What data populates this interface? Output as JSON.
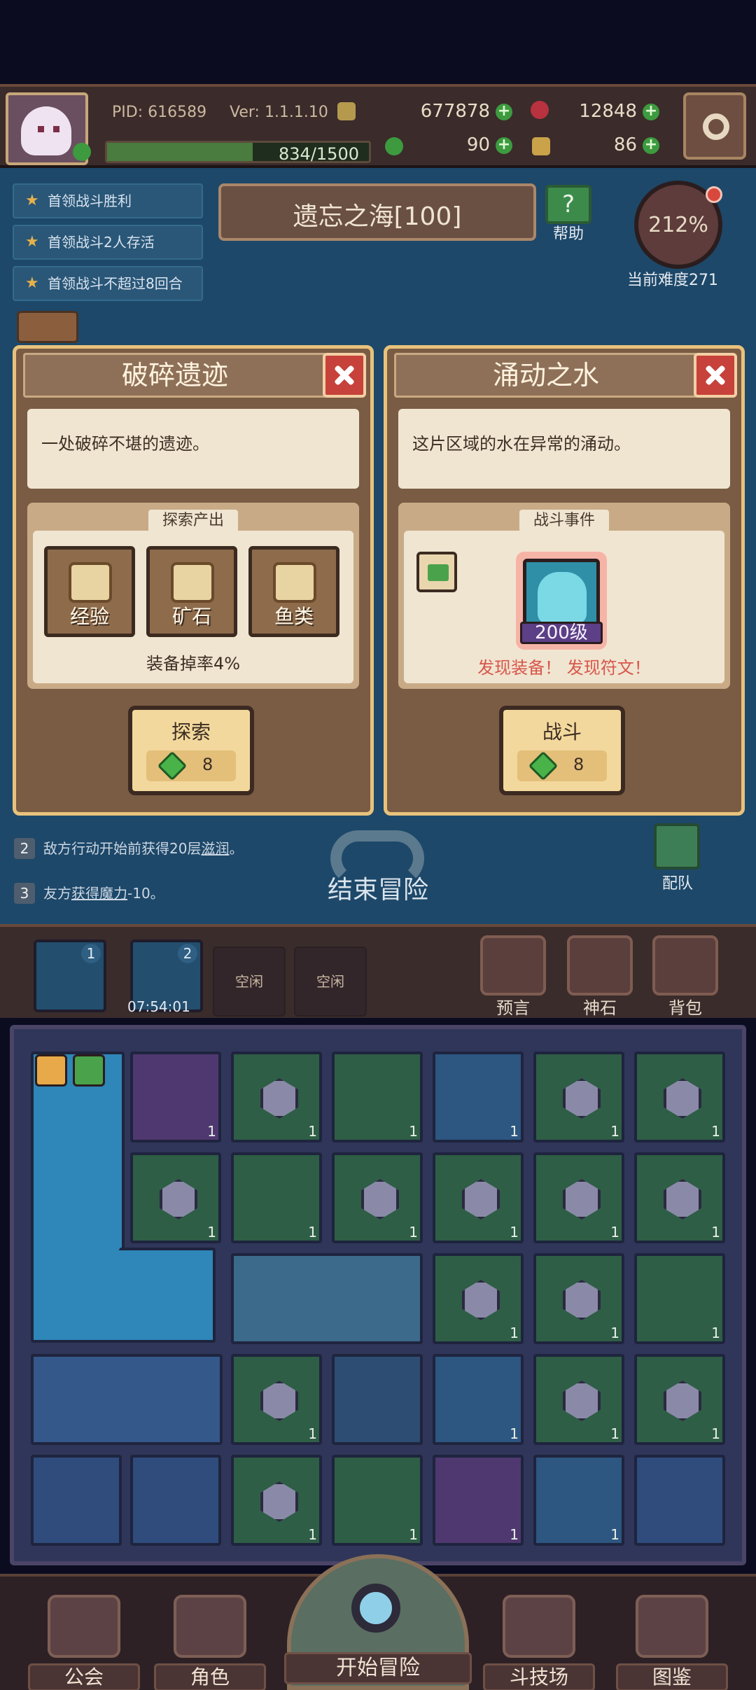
{
  "header": {
    "pid": "PID: 616589",
    "version": "Ver: 1.1.1.10",
    "gold": "677878",
    "gems": "12848",
    "energy_text": "834/1500",
    "energy_progress": 0.556,
    "clover": "90",
    "keys": "86"
  },
  "quests": [
    {
      "label": "首领战斗胜利"
    },
    {
      "label": "首领战斗2人存活"
    },
    {
      "label": "首领战斗不超过8回合"
    }
  ],
  "region": {
    "title": "遗忘之海[100]",
    "help_label": "帮助"
  },
  "difficulty": {
    "percent": "212%",
    "label": "当前难度271"
  },
  "card_left": {
    "title": "破碎遗迹",
    "description": "一处破碎不堪的遗迹。",
    "section": "探索产出",
    "outputs": [
      {
        "label": "经验"
      },
      {
        "label": "矿石"
      },
      {
        "label": "鱼类"
      }
    ],
    "drop_rate": "装备掉率4%",
    "action_label": "探索",
    "action_cost": "8"
  },
  "card_right": {
    "title": "涌动之水",
    "description": "这片区域的水在异常的涌动。",
    "section": "战斗事件",
    "enemy_level": "200级",
    "found_text": "发现装备！ 发现符文！",
    "action_label": "战斗",
    "action_cost": "8"
  },
  "effects": [
    {
      "num": "2",
      "before": "敌方行动开始前获得20层",
      "keyword": "滋润",
      "after": "。"
    },
    {
      "num": "3",
      "before": "友方",
      "keyword": "获得魔力",
      "after": "-10。"
    }
  ],
  "end_adventure": "结束冒险",
  "team_label": "配队",
  "dock": {
    "slot1_num": "1",
    "slot2_num": "2",
    "timer": "07:54:01",
    "idle1": "空闲",
    "idle2": "空闲",
    "tools": [
      {
        "label": "预言"
      },
      {
        "label": "神石"
      },
      {
        "label": "背包"
      }
    ]
  },
  "inventory_qty": "1",
  "nav": [
    {
      "label": "公会"
    },
    {
      "label": "角色"
    },
    {
      "label": "开始冒险"
    },
    {
      "label": "斗技场"
    },
    {
      "label": "图鉴"
    }
  ],
  "colors": {
    "card_border": "#e8c27c",
    "close_red": "#c6423b",
    "found_red": "#d8564b",
    "gem_green": "#49b34a"
  }
}
